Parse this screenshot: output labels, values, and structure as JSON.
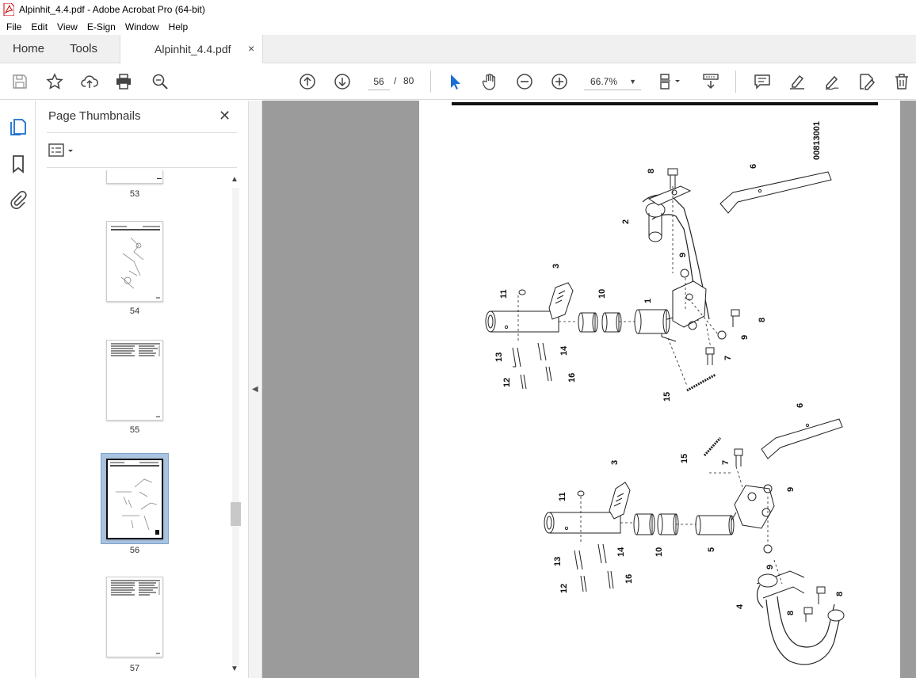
{
  "window": {
    "title": "Alpinhit_4.4.pdf - Adobe Acrobat Pro (64-bit)"
  },
  "menu": [
    "File",
    "Edit",
    "View",
    "E-Sign",
    "Window",
    "Help"
  ],
  "tabs": {
    "home": "Home",
    "tools": "Tools",
    "document": "Alpinhit_4.4.pdf",
    "close": "×"
  },
  "toolbar": {
    "current_page": "56",
    "separator": "/",
    "total_pages": "80",
    "zoom": "66.7%"
  },
  "sidebar": {
    "title": "Page Thumbnails",
    "close": "✕",
    "thumbnails": [
      {
        "page": "53"
      },
      {
        "page": "54"
      },
      {
        "page": "55"
      },
      {
        "page": "56",
        "selected": true
      },
      {
        "page": "57"
      }
    ]
  },
  "document": {
    "figure_code": "00813001",
    "labels_upper": [
      "8",
      "6",
      "2",
      "9",
      "3",
      "11",
      "10",
      "1",
      "8",
      "9",
      "7",
      "13",
      "14",
      "16",
      "12",
      "15"
    ],
    "labels_lower": [
      "6",
      "3",
      "15",
      "7",
      "11",
      "9",
      "10",
      "5",
      "14",
      "13",
      "16",
      "12",
      "9",
      "4",
      "8",
      "8"
    ]
  }
}
